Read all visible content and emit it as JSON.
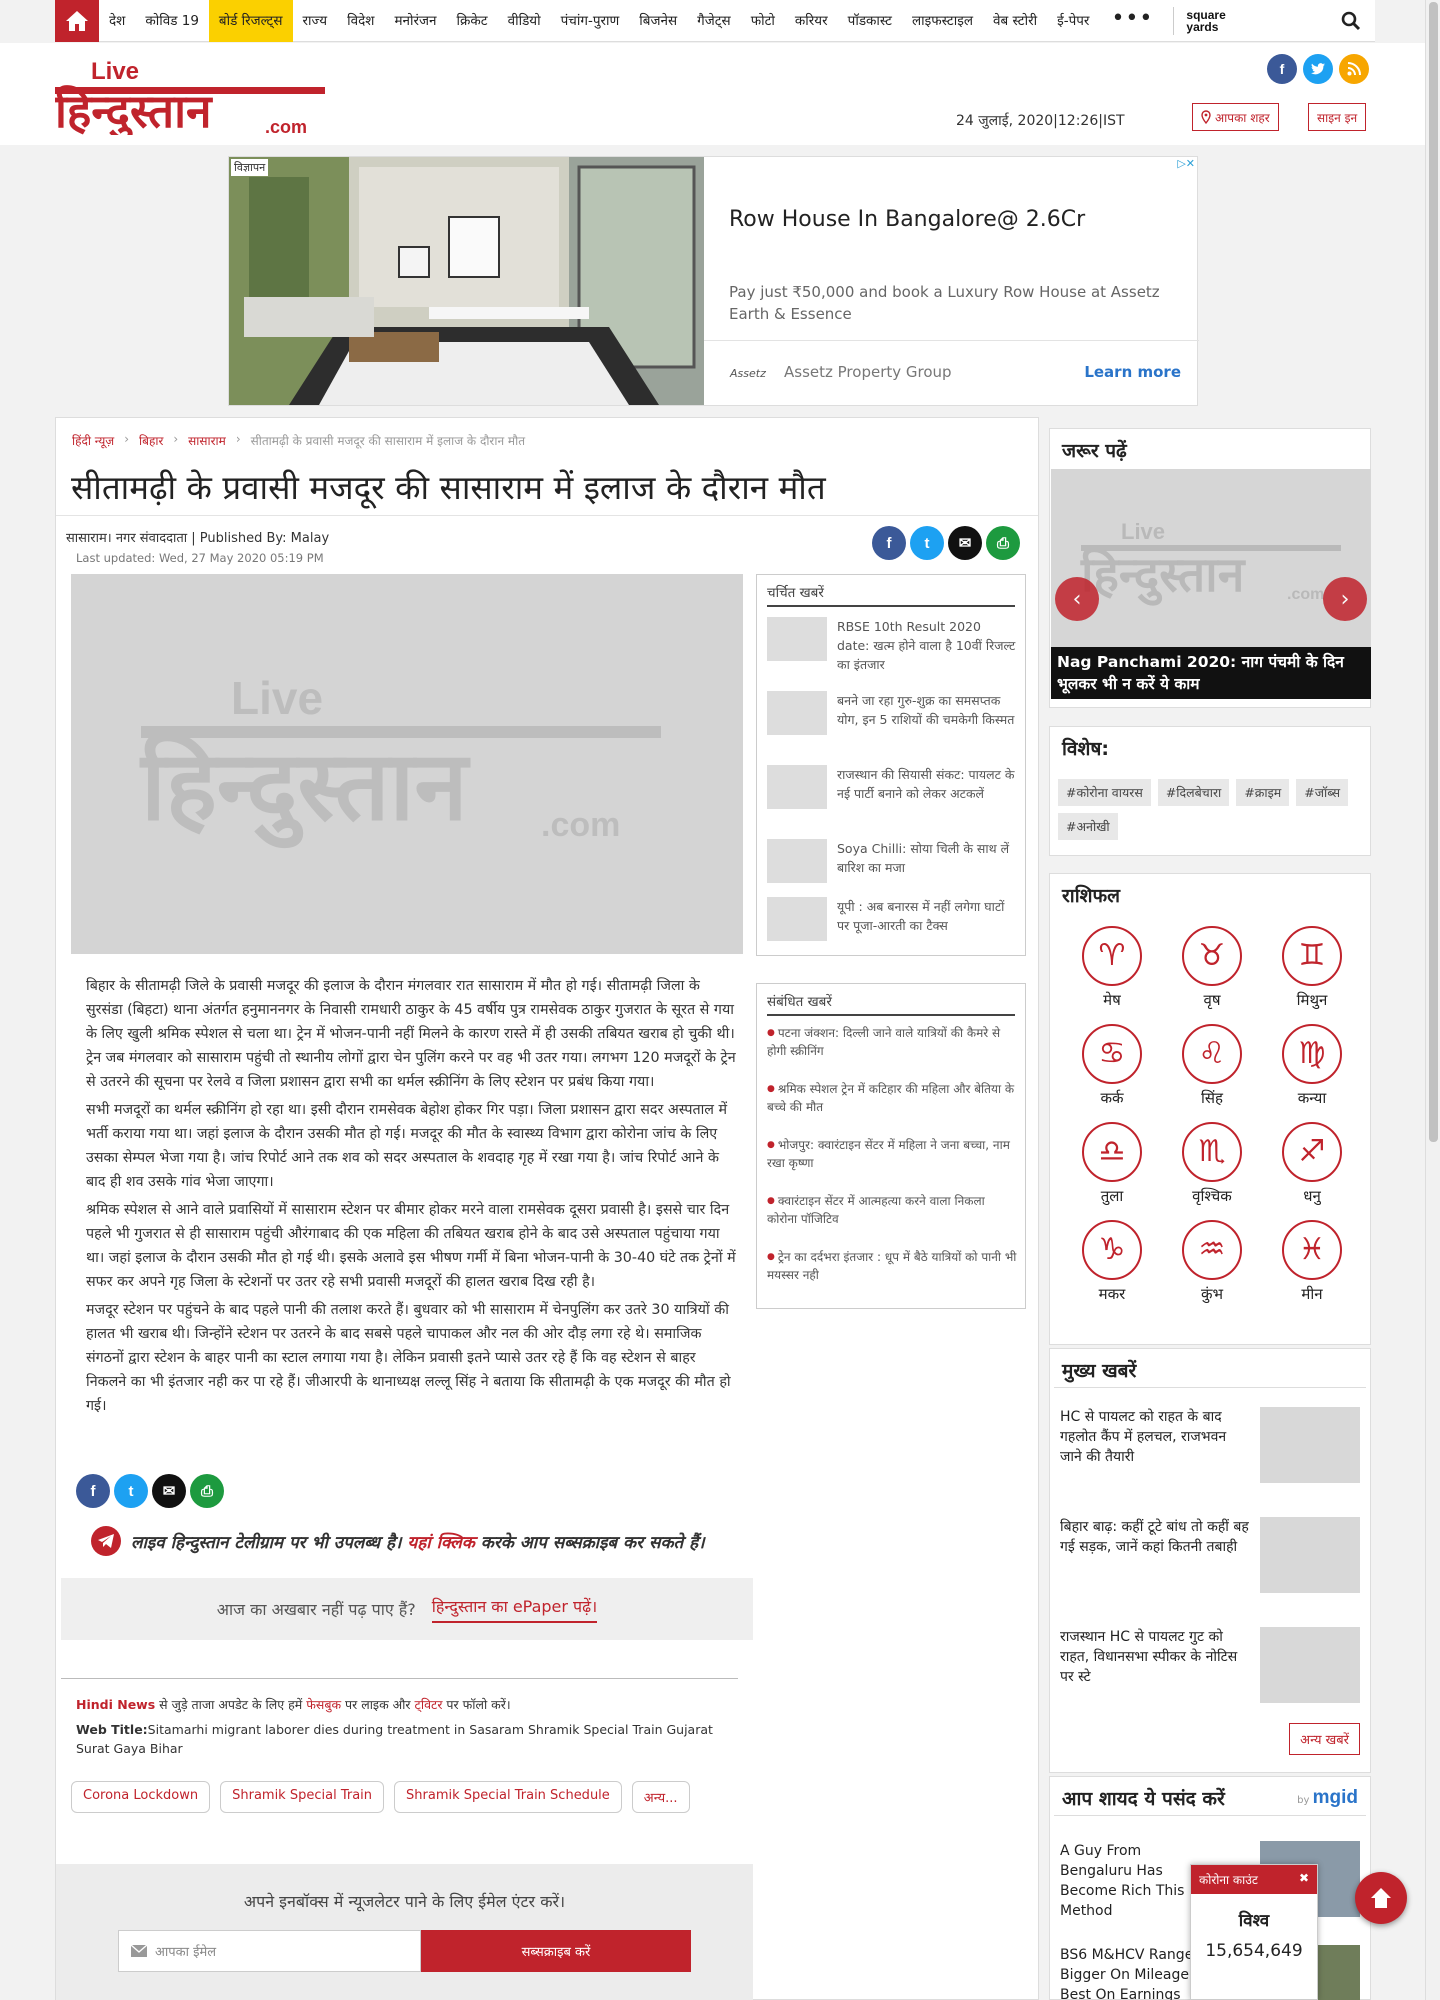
{
  "nav": {
    "items": [
      "देश",
      "कोविड 19",
      "बोर्ड रिजल्ट्स",
      "राज्य",
      "विदेश",
      "मनोरंजन",
      "क्रिकेट",
      "वीडियो",
      "पंचांग-पुराण",
      "बिजनेस",
      "गैजेट्स",
      "फोटो",
      "करियर",
      "पॉडकास्ट",
      "लाइफस्टाइल",
      "वेब स्टोरी",
      "ई-पेपर"
    ],
    "highlighted": "बोर्ड रिजल्ट्स",
    "more": "•••",
    "partner": [
      "square",
      "yards"
    ]
  },
  "header": {
    "logo_live": "Live",
    "logo_main": "हिन्दुस्तान",
    "logo_com": ".com",
    "date": "24 जुलाई, 2020|12:26|IST",
    "city_button": "आपका शहर",
    "signin_button": "साइन इन"
  },
  "ad": {
    "label": "विज्ञापन",
    "title": "Row House In Bangalore@ 2.6Cr",
    "desc": "Pay just ₹50,000 and book a Luxury Row House at Assetz Earth & Essence",
    "brand": "Assetz Property Group",
    "brand_logo": "Assetz",
    "cta": "Learn more"
  },
  "breadcrumb": [
    "हिंदी न्यूज़",
    "बिहार",
    "सासाराम",
    "सीतामढ़ी के प्रवासी मजदूर की सासाराम में इलाज के दौरान मौत"
  ],
  "article": {
    "title": "सीतामढ़ी के प्रवासी मजदूर की सासाराम में इलाज के दौरान मौत",
    "byline": "सासाराम। नगर संवाददाता    | Published By: Malay",
    "updated": "Last updated: Wed, 27 May 2020 05:19 PM",
    "paragraphs": [
      "बिहार के सीतामढ़ी जिले के प्रवासी मजदूर की इलाज के दौरान मंगलवार रात सासाराम में मौत हो गई। सीतामढ़ी जिला के सुरसंडा (बिहटा) थाना अंतर्गत हनुमाननगर के निवासी रामधारी ठाकुर के 45 वर्षीय पुत्र रामसेवक ठाकुर गुजरात के सूरत से गया के लिए खुली श्रमिक स्पेशल से चला था। ट्रेन में भोजन-पानी नहीं मिलने के कारण रास्ते में ही उसकी तबियत खराब हो चुकी थी। ट्रेन जब मंगलवार को सासाराम पहुंची तो स्थानीय लोगों द्वारा चेन पुलिंग करने पर वह भी उतर गया। लगभग 120 मजदूरों के ट्रेन से उतरने की सूचना पर रेलवे व जिला प्रशासन द्वारा सभी का थर्मल स्क्रीनिंग के लिए स्टेशन पर प्रबंध किया गया।",
      "सभी मजदूरों का थर्मल स्क्रीनिंग हो रहा था। इसी दौरान रामसेवक बेहोश होकर गिर पड़ा। जिला प्रशासन द्वारा सदर अस्पताल में भर्ती कराया गया था। जहां इलाज के दौरान उसकी मौत हो गई। मजदूर की मौत के स्वास्थ्य विभाग द्वारा कोरोना जांच के लिए उसका सेम्पल भेजा गया है। जांच रिपोर्ट आने तक शव को सदर अस्पताल के शवदाह गृह में रखा गया है। जांच रिपोर्ट आने के बाद ही शव उसके गांव भेजा जाएगा।",
      "श्रमिक स्पेशल से आने वाले प्रवासियों में सासाराम स्टेशन पर बीमार होकर मरने वाला रामसेवक दूसरा प्रवासी है। इससे चार दिन पहले भी गुजरात से ही सासाराम पहुंची औरंगाबाद की एक महिला की तबियत खराब होने के बाद उसे अस्पताल पहुंचाया गया था। जहां इलाज के दौरान उसकी मौत हो गई थी। इसके अलावे इस भीषण गर्मी में बिना भोजन-पानी के 30-40 घंटे तक ट्रेनों में सफर कर अपने गृह जिला के स्टेशनों पर उतर रहे सभी प्रवासी मजदूरों की हालत खराब दिख रही है।",
      "मजदूर स्टेशन पर पहुंचने के बाद पहले पानी की तलाश करते हैं। बुधवार को भी सासाराम में चेनपुलिंग कर उतरे 30 यात्रियों की हालत भी खराब थी। जिन्होंने स्टेशन पर उतरने के बाद सबसे पहले चापाकल और नल की ओर दौड़ लगा रहे थे। समाजिक संगठनों द्वारा स्टेशन के बाहर पानी का स्टाल लगाया गया है। लेकिन प्रवासी इतने प्यासे उतर रहे  हैं कि वह स्टेशन से बाहर निकलने का भी इंतजार नही कर पा रहे हैं। जीआरपी के थानाध्यक्ष लल्लू सिंह ने बताया कि सीतामढ़ी के एक मजदूर की  मौत हो गई।"
    ]
  },
  "telegram": {
    "pre": "लाइव हिन्दुस्तान टेलीग्राम पर भी उपलब्ध है। ",
    "link": "यहां क्लिक",
    "post": " करके आप सब्सक्राइब कर सकते हैं।"
  },
  "epaper": {
    "text": "आज का अखबार नहीं पढ़ पाए हैं?",
    "link": "हिन्दुस्तान का ePaper पढ़ें।"
  },
  "follow": {
    "hindi_news": "Hindi News",
    "t1": " से जुड़े ताजा अपडेट के लिए हमें ",
    "fb": "फेसबुक",
    "t2": " पर लाइक और ",
    "tw": "ट्विटर",
    "t3": " पर फॉलो करें।"
  },
  "web_title": {
    "label": "Web Title:",
    "text": "Sitamarhi migrant laborer dies during treatment in Sasaram Shramik Special Train Gujarat Surat Gaya Bihar"
  },
  "tags": [
    "Corona Lockdown",
    "Shramik Special Train",
    "Shramik Special Train Schedule",
    "अन्य..."
  ],
  "newsletter": {
    "text": "अपने इनबॉक्स में न्यूजलेटर पाने के लिए ईमेल एंटर करें।",
    "placeholder": "आपका ईमेल",
    "button": "सब्सक्राइब करें"
  },
  "trending": {
    "heading": "चर्चित खबरें",
    "items": [
      "RBSE 10th Result 2020 date: खत्म होने वाला है 10वीं रिजल्ट का इंतजार",
      "बनने जा रहा गुरु-शुक्र का समसप्तक योग, इन 5 राशियों की चमकेगी किस्मत",
      "राजस्थान की सियासी संकट: पायलट के नई पार्टी बनाने को लेकर अटकलें",
      "Soya Chilli: सोया चिली के साथ लें बारिश का मजा",
      "यूपी : अब बनारस में नहीं लगेगा घाटों पर पूजा-आरती का टैक्स"
    ]
  },
  "related": {
    "heading": "संबंधित खबरें",
    "items": [
      "पटना जंक्शन: दिल्ली जाने वाले यात्रियों की कैमरे से होगी स्क्रीनिंग",
      "श्रमिक स्पेशल ट्रेन में कटिहार की महिला और बेतिया के बच्चे की मौत",
      "भोजपुर: क्वारंटाइन सेंटर में महिला ने जना बच्चा, नाम रखा कृष्णा",
      "क्वारंटाइन सेंटर में आत्महत्या करने वाला निकला कोरोना पॉजिटिव",
      "ट्रेन का दर्दभरा इंतजार : धूप में बैठे यात्रियों को पानी भी मयस्सर नही"
    ]
  },
  "must_read": {
    "heading": "जरूर पढ़ें",
    "caption": "Nag Panchami 2020: नाग पंचमी के दिन भूलकर भी न करें ये काम",
    "prev": "‹",
    "next": "›"
  },
  "special": {
    "heading": "विशेष:",
    "tags": [
      "#कोरोना वायरस",
      "#दिलबेचारा",
      "#क्राइम",
      "#जॉब्स",
      "#अनोखी"
    ]
  },
  "rashifal": {
    "heading": "राशिफल",
    "signs": [
      "मेष",
      "वृष",
      "मिथुन",
      "कर्क",
      "सिंह",
      "कन्या",
      "तुला",
      "वृश्चिक",
      "धनु",
      "मकर",
      "कुंभ",
      "मीन"
    ]
  },
  "top_news": {
    "heading": "मुख्य खबरें",
    "items": [
      "HC से पायलट को राहत के बाद गहलोत कैंप में हलचल, राजभवन जाने की तैयारी",
      "बिहार बाढ़: कहीं टूटे बांध तो कहीं बह गई सड़क, जानें कहां कितनी तबाही",
      "राजस्थान HC से पायलट गुट को राहत, विधानसभा स्पीकर के नोटिस पर स्टे"
    ],
    "more": "अन्य खबरें"
  },
  "recommend": {
    "heading": "आप शायद ये पसंद करें",
    "by": "by",
    "brand": "mgid",
    "items": [
      "A Guy From Bengaluru Has Become Rich This Method",
      "BS6 M&HCV Range Bigger On Mileage, Best On Earnings"
    ]
  },
  "corona": {
    "title": "कोरोना काउंट",
    "close": "✖",
    "region": "विश्व",
    "count": "15,654,649"
  },
  "colors": {
    "brand": "#c0232c",
    "highlight": "#fbd000"
  }
}
